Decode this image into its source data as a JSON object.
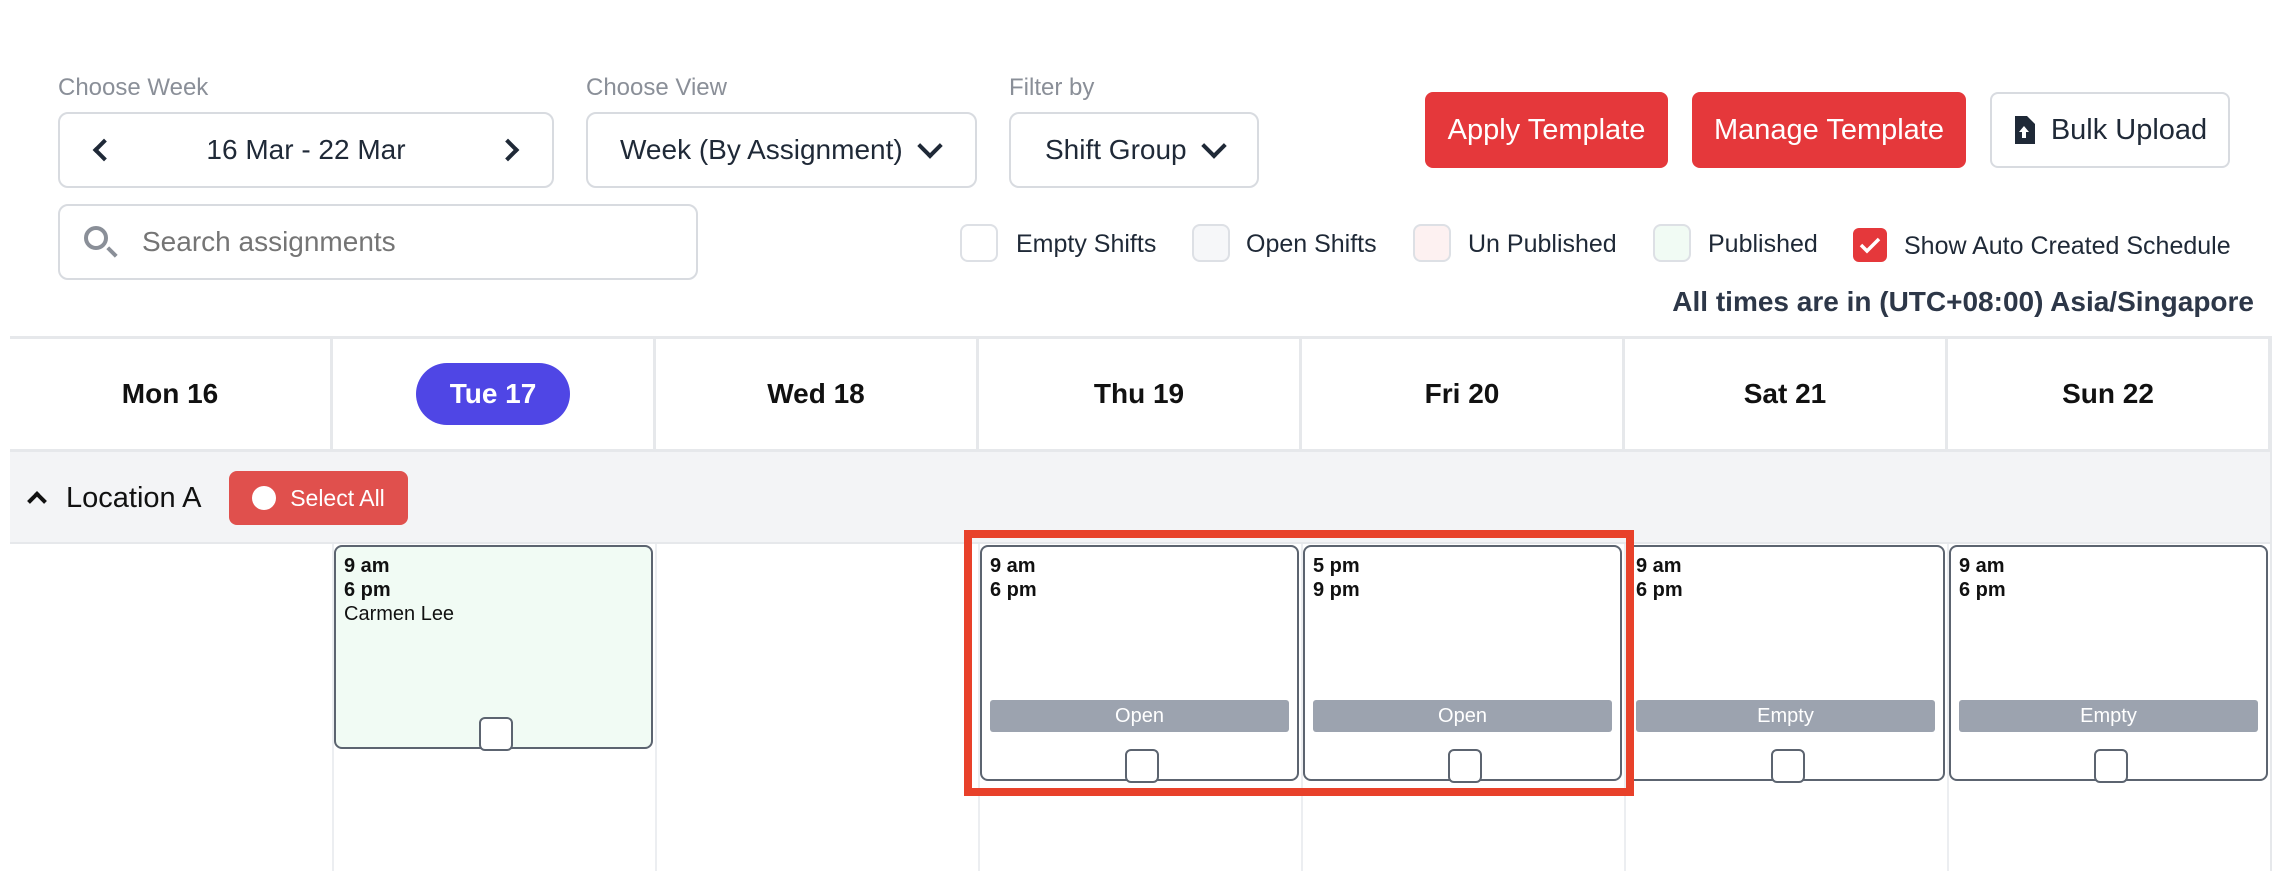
{
  "week": {
    "label": "Choose Week",
    "range": "16 Mar - 22 Mar"
  },
  "view": {
    "label": "Choose View",
    "value": "Week (By Assignment)"
  },
  "filter": {
    "label": "Filter by",
    "value": "Shift Group"
  },
  "search": {
    "placeholder": "Search assignments"
  },
  "buttons": {
    "apply_template": "Apply Template",
    "manage_template": "Manage Template",
    "bulk_upload": "Bulk Upload"
  },
  "legend": {
    "empty": "Empty Shifts",
    "open": "Open Shifts",
    "unpublished": "Un Published",
    "published": "Published",
    "auto_created": "Show Auto Created Schedule"
  },
  "timezone_note": "All times are in (UTC+08:00) Asia/Singapore",
  "days": [
    {
      "label": "Mon 16"
    },
    {
      "label": "Tue 17"
    },
    {
      "label": "Wed 18"
    },
    {
      "label": "Thu 19"
    },
    {
      "label": "Fri 20"
    },
    {
      "label": "Sat 21"
    },
    {
      "label": "Sun 22"
    }
  ],
  "group": {
    "name": "Location A",
    "select_all": "Select All"
  },
  "shifts": [
    {
      "start": "9 am",
      "end": "6 pm",
      "assignee": "Carmen Lee"
    },
    {
      "start": "9 am",
      "end": "6 pm",
      "status": "Open"
    },
    {
      "start": "5 pm",
      "end": "9 pm",
      "status": "Open"
    },
    {
      "start": "9 am",
      "end": "6 pm",
      "status": "Empty"
    },
    {
      "start": "9 am",
      "end": "6 pm",
      "status": "Empty"
    }
  ],
  "colors": {
    "accent_red": "#e5383b",
    "today": "#4f46e5",
    "published_bg": "#f1fbf4",
    "highlight": "#e8412a"
  }
}
